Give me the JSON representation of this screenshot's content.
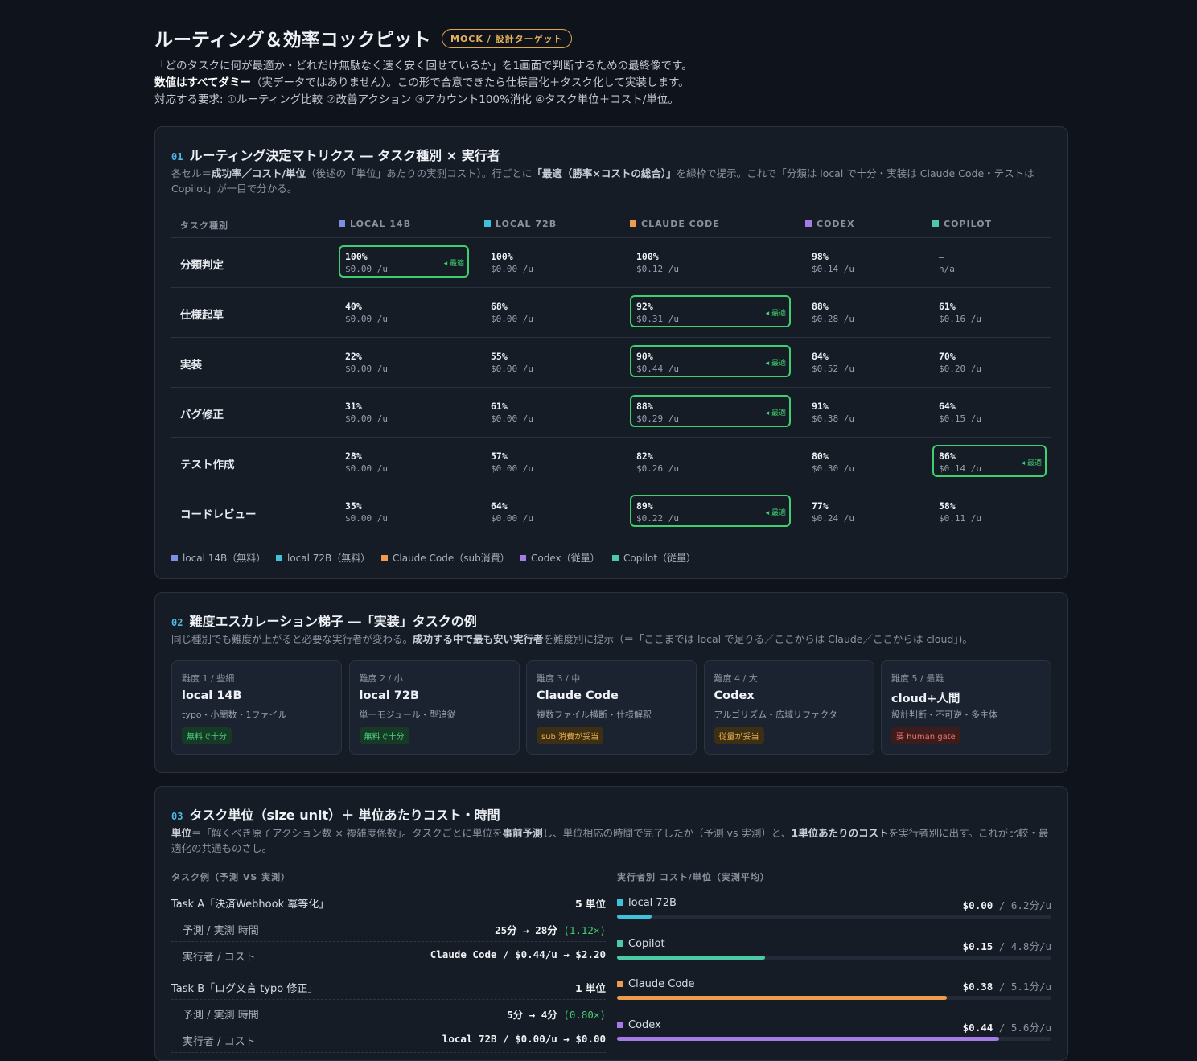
{
  "header": {
    "title": "ルーティング＆効率コックピット",
    "badge": "MOCK / 設計ターゲット",
    "line1": "「どのタスクに何が最適か・どれだけ無駄なく速く安く回せているか」を1画面で判断するための最終像です。",
    "line2_bold": "数値はすべてダミー",
    "line2_rest": "（実データではありません）。この形で合意できたら仕様書化＋タスク化して実装します。",
    "line3": "対応する要求: ①ルーティング比較 ②改善アクション ③アカウント100%消化 ④タスク単位＋コスト/単位。"
  },
  "colors": {
    "local14": "#7b8fe6",
    "local72": "#3fc1d9",
    "claude": "#ee9a4f",
    "codex": "#a67be8",
    "copilot": "#4ec9a6",
    "best": "#3fcf6e"
  },
  "matrix": {
    "num": "01",
    "title": "ルーティング決定マトリクス ― タスク種別 × 実行者",
    "desc_parts": [
      "各セル＝",
      "成功率／コスト/単位",
      "（後述の「単位」あたりの実測コスト）。行ごとに",
      "「最適（勝率×コストの総合）」",
      "を緑枠で提示。これで「分類は local で十分・実装は Claude Code・テストは Copilot」が一目で分かる。"
    ],
    "task_col": "タスク種別",
    "columns": [
      "LOCAL 14B",
      "LOCAL 72B",
      "CLAUDE CODE",
      "CODEX",
      "COPILOT"
    ],
    "best_tag": "◂ 最適",
    "rows": [
      {
        "label": "分類判定",
        "cells": [
          {
            "rate": "100%",
            "cost": "$0.00 /u",
            "best": true
          },
          {
            "rate": "100%",
            "cost": "$0.00 /u",
            "best": false
          },
          {
            "rate": "100%",
            "cost": "$0.12 /u",
            "best": false
          },
          {
            "rate": "98%",
            "cost": "$0.14 /u",
            "best": false
          },
          {
            "rate": "—",
            "cost": "n/a",
            "best": false
          }
        ]
      },
      {
        "label": "仕様起草",
        "cells": [
          {
            "rate": "40%",
            "cost": "$0.00 /u",
            "best": false
          },
          {
            "rate": "68%",
            "cost": "$0.00 /u",
            "best": false
          },
          {
            "rate": "92%",
            "cost": "$0.31 /u",
            "best": true
          },
          {
            "rate": "88%",
            "cost": "$0.28 /u",
            "best": false
          },
          {
            "rate": "61%",
            "cost": "$0.16 /u",
            "best": false
          }
        ]
      },
      {
        "label": "実装",
        "cells": [
          {
            "rate": "22%",
            "cost": "$0.00 /u",
            "best": false
          },
          {
            "rate": "55%",
            "cost": "$0.00 /u",
            "best": false
          },
          {
            "rate": "90%",
            "cost": "$0.44 /u",
            "best": true
          },
          {
            "rate": "84%",
            "cost": "$0.52 /u",
            "best": false
          },
          {
            "rate": "70%",
            "cost": "$0.20 /u",
            "best": false
          }
        ]
      },
      {
        "label": "バグ修正",
        "cells": [
          {
            "rate": "31%",
            "cost": "$0.00 /u",
            "best": false
          },
          {
            "rate": "61%",
            "cost": "$0.00 /u",
            "best": false
          },
          {
            "rate": "88%",
            "cost": "$0.29 /u",
            "best": true
          },
          {
            "rate": "91%",
            "cost": "$0.38 /u",
            "best": false
          },
          {
            "rate": "64%",
            "cost": "$0.15 /u",
            "best": false
          }
        ]
      },
      {
        "label": "テスト作成",
        "cells": [
          {
            "rate": "28%",
            "cost": "$0.00 /u",
            "best": false
          },
          {
            "rate": "57%",
            "cost": "$0.00 /u",
            "best": false
          },
          {
            "rate": "82%",
            "cost": "$0.26 /u",
            "best": false
          },
          {
            "rate": "80%",
            "cost": "$0.30 /u",
            "best": false
          },
          {
            "rate": "86%",
            "cost": "$0.14 /u",
            "best": true
          }
        ]
      },
      {
        "label": "コードレビュー",
        "cells": [
          {
            "rate": "35%",
            "cost": "$0.00 /u",
            "best": false
          },
          {
            "rate": "64%",
            "cost": "$0.00 /u",
            "best": false
          },
          {
            "rate": "89%",
            "cost": "$0.22 /u",
            "best": true
          },
          {
            "rate": "77%",
            "cost": "$0.24 /u",
            "best": false
          },
          {
            "rate": "58%",
            "cost": "$0.11 /u",
            "best": false
          }
        ]
      }
    ],
    "legend": [
      "local 14B（無料）",
      "local 72B（無料）",
      "Claude Code（sub消費）",
      "Codex（従量）",
      "Copilot（従量）"
    ]
  },
  "ladder": {
    "num": "02",
    "title": "難度エスカレーション梯子 ―「実装」タスクの例",
    "desc_a": "同じ種別でも難度が上がると必要な実行者が変わる。",
    "desc_b": "成功する中で最も安い実行者",
    "desc_c": "を難度別に提示（＝「ここまでは local で足りる／ここからは Claude／ここからは cloud」)。",
    "steps": [
      {
        "level": "難度 1 / 些細",
        "name": "local 14B",
        "desc": "typo・小関数・1ファイル",
        "pill": "無料で十分",
        "tone": "green"
      },
      {
        "level": "難度 2 / 小",
        "name": "local 72B",
        "desc": "単一モジュール・型追従",
        "pill": "無料で十分",
        "tone": "green"
      },
      {
        "level": "難度 3 / 中",
        "name": "Claude Code",
        "desc": "複数ファイル横断・仕様解釈",
        "pill": "sub 消費が妥当",
        "tone": "amber"
      },
      {
        "level": "難度 4 / 大",
        "name": "Codex",
        "desc": "アルゴリズム・広域リファクタ",
        "pill": "従量が妥当",
        "tone": "amber"
      },
      {
        "level": "難度 5 / 最難",
        "name": "cloud+人間",
        "desc": "設計判断・不可逆・多主体",
        "pill": "要 human gate",
        "tone": "red"
      }
    ]
  },
  "units": {
    "num": "03",
    "title": "タスク単位（size unit）＋ 単位あたりコスト・時間",
    "desc_parts": [
      "単位",
      "＝「解くべき原子アクション数 × 複雑度係数」。タスクごとに単位を",
      "事前予測",
      "し、単位相応の時間で完了したか（予測 vs 実測）と、",
      "1単位あたりのコスト",
      "を実行者別に出す。これが比較・最適化の共通ものさし。"
    ],
    "left_heading": "タスク例（予測 VS 実測）",
    "right_heading": "実行者別 コスト/単位（実測平均）",
    "tasks": [
      {
        "name": "Task A「決済Webhook 冪等化」",
        "units": "5 単位",
        "time_label": "予測 / 実測 時間",
        "time_value": "25分 → 28分",
        "ratio": "(1.12×)",
        "cost_label": "実行者 / コスト",
        "cost_value": "Claude Code / $0.44/u → $2.20"
      },
      {
        "name": "Task B「ログ文言 typo 修正」",
        "units": "1 単位",
        "time_label": "予測 / 実測 時間",
        "time_value": "5分 → 4分",
        "ratio": "(0.80×)",
        "cost_label": "実行者 / コスト",
        "cost_value": "local 72B / $0.00/u → $0.00"
      }
    ],
    "executors": [
      {
        "name": "local 72B",
        "cost": "$0.00",
        "time": "/ 6.2分/u",
        "bar": 0.08,
        "color": "#3fc1d9"
      },
      {
        "name": "Copilot",
        "cost": "$0.15",
        "time": "/ 4.8分/u",
        "bar": 0.34,
        "color": "#4ec9a6"
      },
      {
        "name": "Claude Code",
        "cost": "$0.38",
        "time": "/ 5.1分/u",
        "bar": 0.76,
        "color": "#ee9a4f"
      },
      {
        "name": "Codex",
        "cost": "$0.44",
        "time": "/ 5.6分/u",
        "bar": 0.88,
        "color": "#a67be8"
      }
    ]
  }
}
